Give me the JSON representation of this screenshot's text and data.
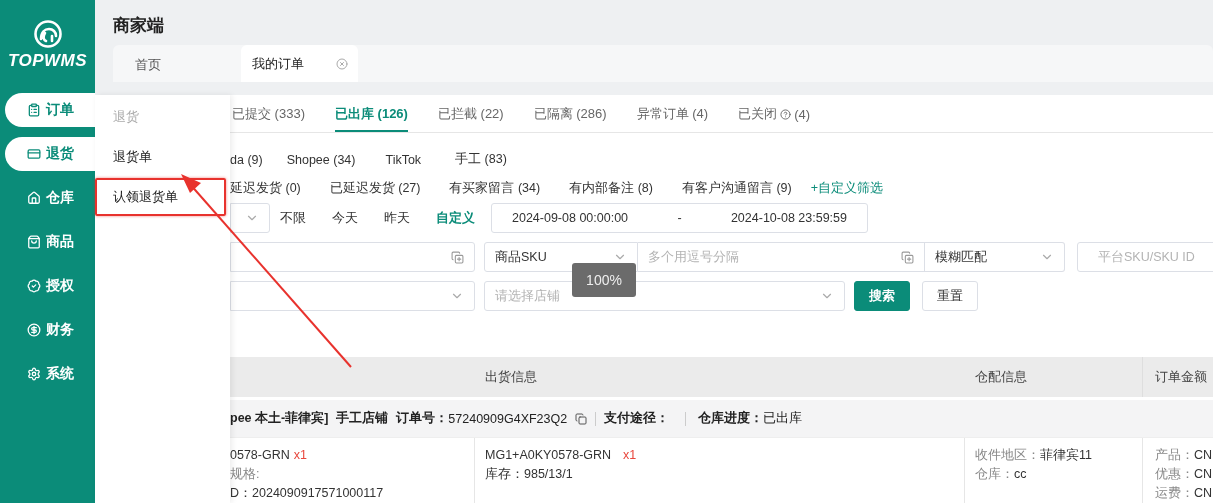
{
  "logo": {
    "text": "TOPWMS"
  },
  "sidebar": {
    "items": [
      {
        "label": "订单",
        "selected": true
      },
      {
        "label": "退货",
        "selected": true
      },
      {
        "label": "仓库",
        "selected": false
      },
      {
        "label": "商品",
        "selected": false
      },
      {
        "label": "授权",
        "selected": false
      },
      {
        "label": "财务",
        "selected": false
      },
      {
        "label": "系统",
        "selected": false
      }
    ]
  },
  "header": {
    "title": "商家端"
  },
  "page_tabs": [
    {
      "label": "首页",
      "selected": false,
      "closable": false
    },
    {
      "label": "我的订单",
      "selected": true,
      "closable": true
    }
  ],
  "flyout": {
    "heading": "退货",
    "items": [
      {
        "label": "退货单",
        "annotated": false
      },
      {
        "label": "认领退货单",
        "annotated": true
      }
    ]
  },
  "status_tabs": [
    {
      "label": "已提交 (333)",
      "selected": false,
      "help_icon": false
    },
    {
      "label": "已出库 (126)",
      "selected": true,
      "help_icon": false
    },
    {
      "label": "已拦截 (22)",
      "selected": false,
      "help_icon": false
    },
    {
      "label": "已隔离 (286)",
      "selected": false,
      "help_icon": false
    },
    {
      "label": "异常订单 (4)",
      "selected": false,
      "help_icon": false
    },
    {
      "label": "已关闭",
      "count": "(4)",
      "selected": false,
      "help_icon": true
    }
  ],
  "channel_filters": [
    "da (9)",
    "Shopee (34)",
    "TikTok",
    "手工 (83)"
  ],
  "quick_filters": [
    "延迟发货 (0)",
    "已延迟发货 (27)",
    "有买家留言 (34)",
    "有内部备注 (8)",
    "有客户沟通留言 (9)"
  ],
  "custom_filter_link": "+自定义筛选",
  "date_filter": {
    "presets": [
      {
        "label": "不限",
        "selected": false
      },
      {
        "label": "今天",
        "selected": false
      },
      {
        "label": "昨天",
        "selected": false
      },
      {
        "label": "自定义",
        "selected": true
      }
    ],
    "start": "2024-09-08 00:00:00",
    "separator": "-",
    "end": "2024-10-08 23:59:59"
  },
  "search": {
    "sku_type": "商品SKU",
    "sku_placeholder": "多个用逗号分隔",
    "match_mode": "模糊匹配",
    "platform_sku_placeholder": "平台SKU/SKU ID",
    "shop_placeholder": "请选择店铺",
    "buttons": [
      {
        "label": "搜索",
        "kind": "primary"
      },
      {
        "label": "重置",
        "kind": "default"
      }
    ]
  },
  "toast": "100%",
  "table": {
    "columns": [
      "出货信息",
      "仓配信息",
      "订单金额"
    ],
    "order": {
      "shop": "pee 本土-菲律宾]",
      "store_type": "手工店铺",
      "order_no_label": "订单号：",
      "order_no": "57240909G4XF23Q2",
      "payment_label": "支付途径：",
      "progress_label": "仓库进度：",
      "progress": "已出库"
    },
    "product": {
      "sku": "0578-GRN",
      "qty": "x1",
      "spec": "规格:",
      "id": "D：2024090917571000117"
    },
    "shipping": {
      "sku": "MG1+A0KY0578-GRN",
      "qty": "x1",
      "stock": "库存：985/13/1"
    },
    "warehouse": [
      {
        "label": "收件地区：",
        "value": "菲律宾11"
      },
      {
        "label": "仓库：",
        "value": "cc"
      }
    ],
    "amounts": [
      {
        "label": "产品：",
        "value": "CN"
      },
      {
        "label": "优惠：",
        "value": "CN"
      },
      {
        "label": "运费：",
        "value": "CN"
      }
    ]
  }
}
